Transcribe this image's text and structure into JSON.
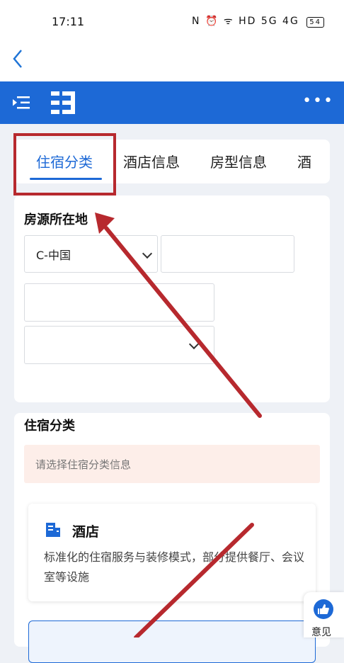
{
  "status_bar": {
    "time": "17:11",
    "icons": "N ⏰ ᯤ HD 5G 4G",
    "battery": "54"
  },
  "nav": {
    "back_icon": "chevron-left-icon"
  },
  "app_bar": {
    "menu_icon": "menu-indent-icon",
    "logo_icon": "app-logo-icon",
    "more_label": "•••"
  },
  "tabs": [
    {
      "label": "住宿分类",
      "active": true
    },
    {
      "label": "酒店信息",
      "active": false
    },
    {
      "label": "房型信息",
      "active": false
    },
    {
      "label": "酒",
      "active": false
    }
  ],
  "location_section": {
    "title": "房源所在地",
    "country_value": "C-中国",
    "field2_value": "",
    "field3_value": "",
    "field4_value": ""
  },
  "category_section": {
    "title": "住宿分类",
    "notice": "请选择住宿分类信息",
    "options": [
      {
        "icon": "hotel-building-icon",
        "title": "酒店",
        "description": "标准化的住宿服务与装修模式，部分提供餐厅、会议室等设施"
      }
    ]
  },
  "feedback": {
    "label": "意见",
    "icon": "thumbs-up-icon"
  },
  "colors": {
    "brand": "#1d69d6",
    "annotation": "#b7292e",
    "notice_bg": "#fdeee9"
  }
}
